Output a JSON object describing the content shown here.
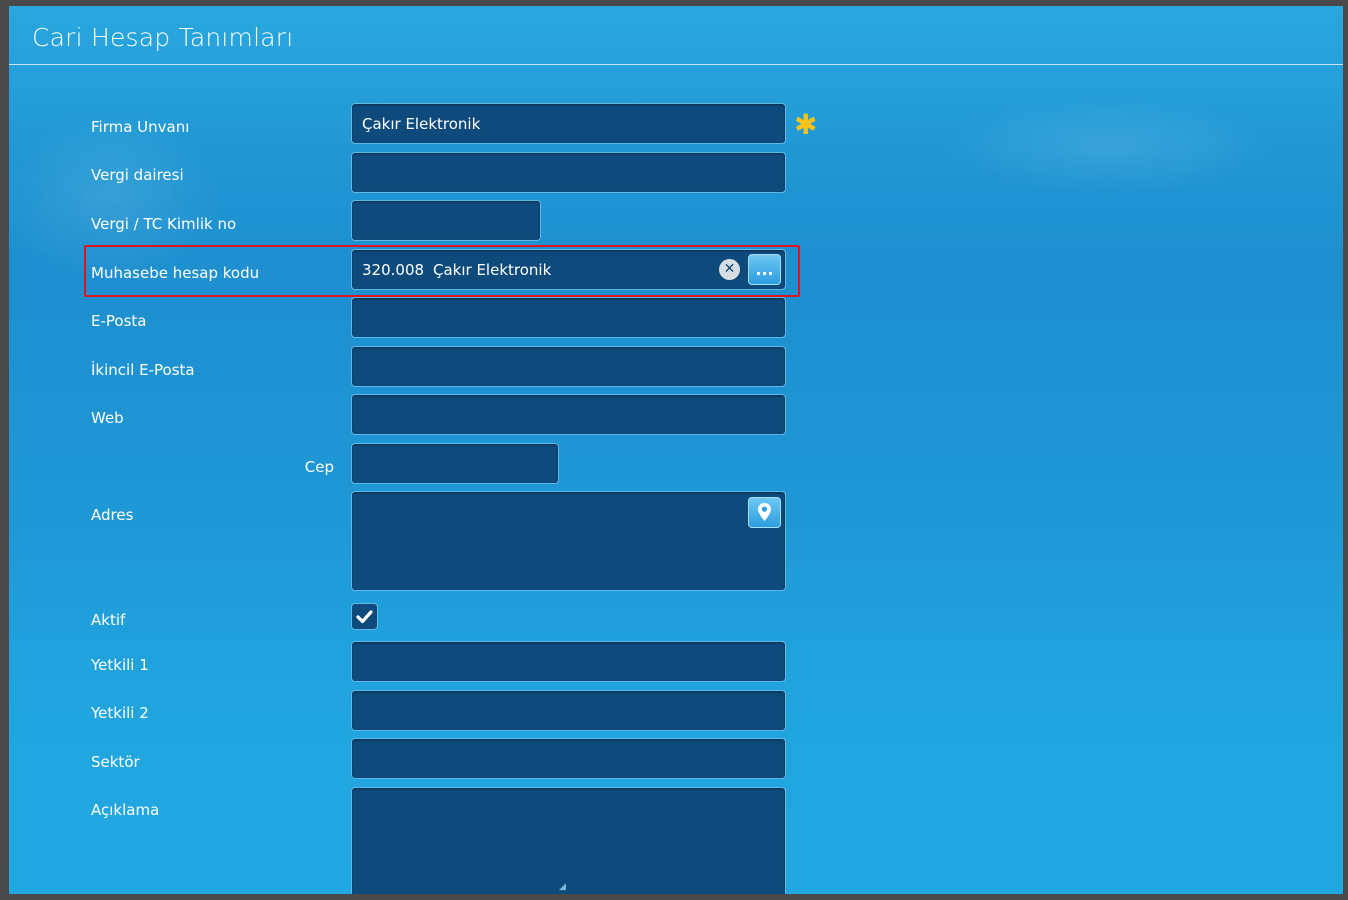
{
  "window": {
    "title": "Cari Hesap Tanımları"
  },
  "form": {
    "firma_unvani": {
      "label": "Firma Unvanı",
      "value": "Çakır Elektronik",
      "required_icon": "asterisk-icon"
    },
    "vergi_dairesi": {
      "label": "Vergi dairesi",
      "value": ""
    },
    "vergi_tc": {
      "label": "Vergi / TC Kimlik no",
      "value": ""
    },
    "muhasebe_hesap_kodu": {
      "label": "Muhasebe hesap kodu",
      "code": "320.008",
      "name": "Çakır Elektronik",
      "lookup_label": "...",
      "clear_icon": "close-icon"
    },
    "eposta": {
      "label": "E-Posta",
      "value": ""
    },
    "ikincil_eposta": {
      "label": "İkincil E-Posta",
      "value": ""
    },
    "web": {
      "label": "Web",
      "value": ""
    },
    "cep": {
      "label": "Cep",
      "value": ""
    },
    "adres": {
      "label": "Adres",
      "value": "",
      "map_icon": "map-pin-icon"
    },
    "aktif": {
      "label": "Aktif",
      "checked": true
    },
    "yetkili1": {
      "label": "Yetkili 1",
      "value": ""
    },
    "yetkili2": {
      "label": "Yetkili 2",
      "value": ""
    },
    "sektor": {
      "label": "Sektör",
      "value": ""
    },
    "aciklama": {
      "label": "Açıklama",
      "value": ""
    }
  },
  "colors": {
    "highlight": "#e0141f",
    "field_bg": "#0e4a7c",
    "required": "#f4c21b"
  }
}
